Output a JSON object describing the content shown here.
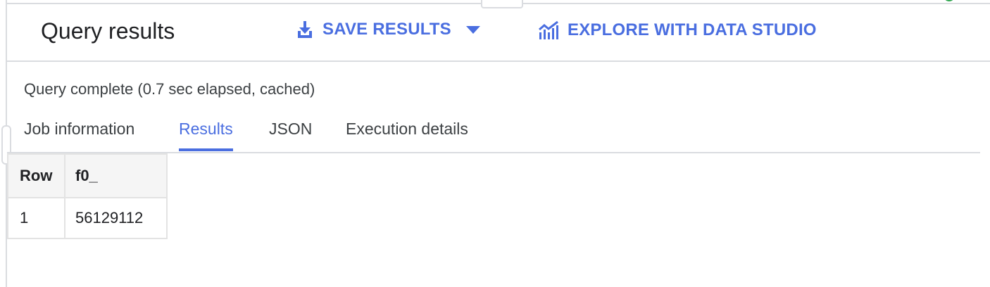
{
  "header": {
    "title": "Query results",
    "save_results_label": "SAVE RESULTS",
    "explore_label": "EXPLORE WITH DATA STUDIO",
    "accent_color": "#4a6ee0"
  },
  "status": {
    "text": "Query complete (0.7 sec elapsed, cached)"
  },
  "tabs": [
    {
      "label": "Job information",
      "active": false
    },
    {
      "label": "Results",
      "active": true
    },
    {
      "label": "JSON",
      "active": false
    },
    {
      "label": "Execution details",
      "active": false
    }
  ],
  "table": {
    "columns": [
      "Row",
      "f0_"
    ],
    "rows": [
      [
        "1",
        "56129112"
      ]
    ]
  },
  "icons": {
    "save": "download-icon",
    "save_menu": "caret-down-icon",
    "explore": "chart-icon"
  }
}
